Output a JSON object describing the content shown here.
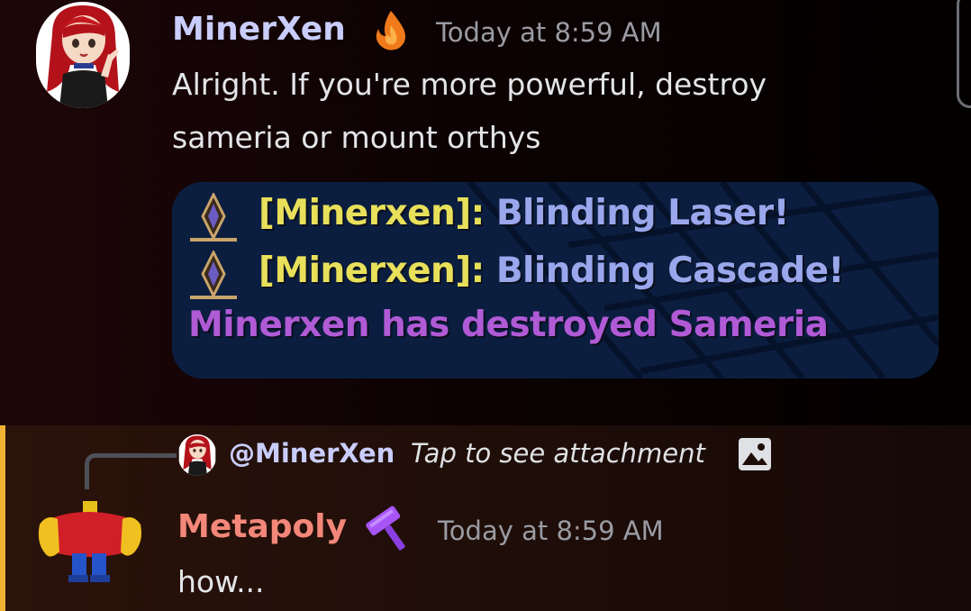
{
  "messages": [
    {
      "author": "MinerXen",
      "timestamp": "Today at 8:59 AM",
      "text": "Alright. If you're more powerful, destroy sameria or mount orthys",
      "badge_icon": "flame-icon",
      "name_color": "#c9cdfb",
      "attachment": {
        "lines": [
          {
            "name": "[Minerxen]:",
            "spell": "Blinding Laser!"
          },
          {
            "name": "[Minerxen]:",
            "spell": "Blinding Cascade!"
          }
        ],
        "system_line": "Minerxen has destroyed Sameria"
      }
    },
    {
      "author": "Metapoly",
      "timestamp": "Today at 8:59 AM",
      "text": "how...",
      "badge_icon": "hammer-icon",
      "name_color": "#f38779",
      "reply": {
        "mention": "@MinerXen",
        "text": "Tap to see attachment",
        "icon": "image-icon"
      }
    }
  ],
  "colors": {
    "mention_highlight_bar": "#f0b232",
    "game_name": "#e8e05a",
    "game_spell": "#9aa7ec",
    "game_system": "#b05ad6"
  }
}
